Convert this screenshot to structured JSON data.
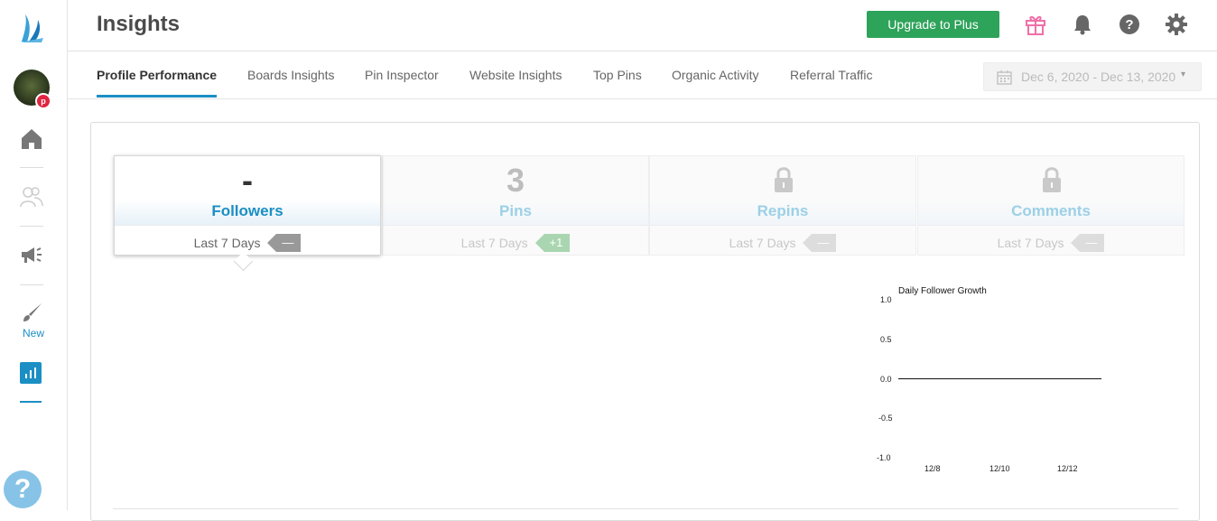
{
  "header": {
    "title": "Insights",
    "upgrade_label": "Upgrade to Plus"
  },
  "icons": [
    "logo-icon",
    "pinterest-icon",
    "home-icon",
    "people-icon",
    "megaphone-icon",
    "brush-icon",
    "insights-icon",
    "help-icon",
    "gift-icon",
    "bell-icon",
    "question-icon",
    "gear-icon",
    "calendar-icon",
    "lock-icon"
  ],
  "sidebar": {
    "new_label": "New",
    "help_label": "?"
  },
  "tabs": [
    {
      "label": "Profile Performance"
    },
    {
      "label": "Boards Insights"
    },
    {
      "label": "Pin Inspector"
    },
    {
      "label": "Website Insights"
    },
    {
      "label": "Top Pins"
    },
    {
      "label": "Organic Activity"
    },
    {
      "label": "Referral Traffic"
    }
  ],
  "active_tab": "Profile Performance",
  "date_range": {
    "label": "Dec 6, 2020 - Dec 13, 2020",
    "caret": "▾"
  },
  "stats": [
    {
      "value": "-",
      "label": "Followers",
      "period": "Last 7 Days",
      "change": "—"
    },
    {
      "value": "3",
      "label": "Pins",
      "period": "Last 7 Days",
      "change": "+1"
    },
    {
      "value": "",
      "label": "Repins",
      "period": "Last 7 Days",
      "change": "—",
      "locked": true
    },
    {
      "value": "",
      "label": "Comments",
      "period": "Last 7 Days",
      "change": "—",
      "locked": true
    }
  ],
  "colors": {
    "accent": "#1b8fc4",
    "upgrade": "#2ea35a",
    "gift": "#f06fa8",
    "positive": "#a9d6b0"
  },
  "chart_data": {
    "type": "line",
    "title": "Daily Follower Growth",
    "x_ticks": [
      "12/8",
      "12/10",
      "12/12"
    ],
    "y_ticks": [
      "1.0",
      "0.5",
      "0.0",
      "-0.5",
      "-1.0"
    ],
    "ylim": [
      -1.0,
      1.0
    ],
    "series": [
      {
        "x": [
          "12/7",
          "12/8",
          "12/9",
          "12/10",
          "12/11",
          "12/12",
          "12/13"
        ],
        "values": [
          0,
          0,
          0,
          0,
          0,
          0,
          0
        ]
      }
    ]
  }
}
